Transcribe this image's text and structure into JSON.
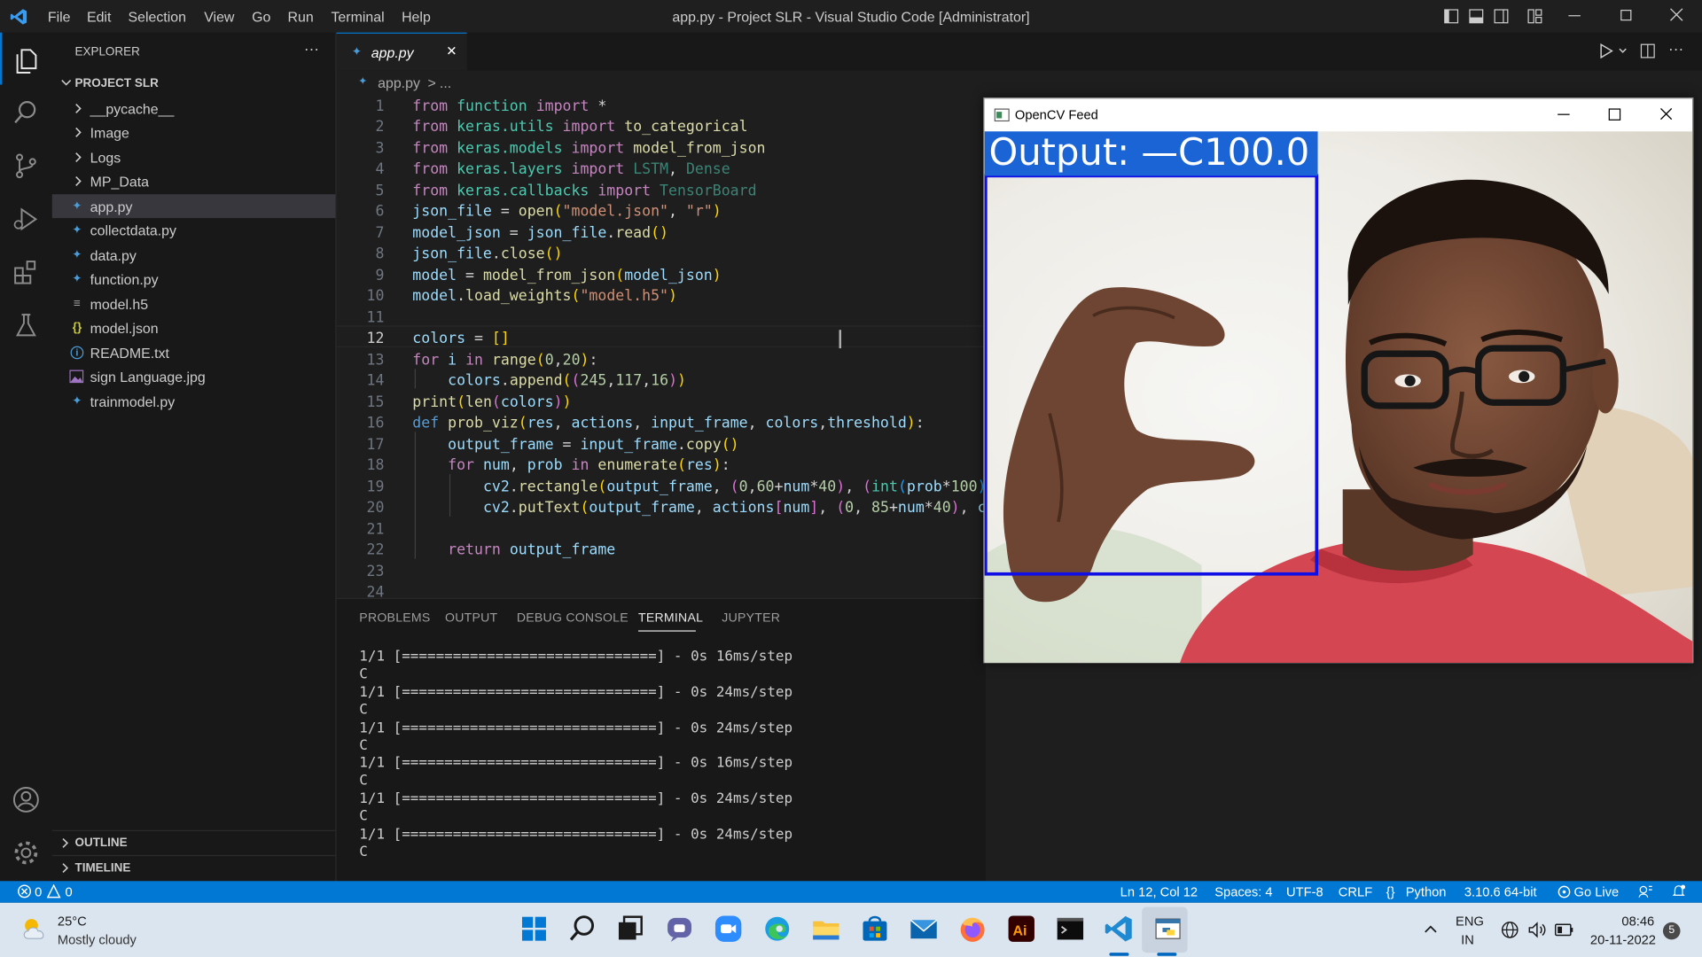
{
  "window": {
    "title": "app.py - Project SLR - Visual Studio Code [Administrator]"
  },
  "menu": [
    "File",
    "Edit",
    "Selection",
    "View",
    "Go",
    "Run",
    "Terminal",
    "Help"
  ],
  "sidebar": {
    "header": "EXPLORER",
    "more": "···",
    "project": "PROJECT SLR",
    "folders": [
      "__pycache__",
      "Image",
      "Logs",
      "MP_Data"
    ],
    "files": [
      "app.py",
      "collectdata.py",
      "data.py",
      "function.py",
      "model.h5",
      "model.json",
      "README.txt",
      "sign Language.jpg",
      "trainmodel.py"
    ],
    "outline": "OUTLINE",
    "timeline": "TIMELINE"
  },
  "tab": {
    "label": "app.py",
    "close": "✕"
  },
  "breadcrumb": {
    "file": "app.py",
    "sep": ">",
    "rest": "..."
  },
  "panel": {
    "tabs": [
      "PROBLEMS",
      "OUTPUT",
      "DEBUG CONSOLE",
      "TERMINAL",
      "JUPYTER"
    ],
    "active": "TERMINAL",
    "lines": [
      "1/1 [==============================] - 0s 16ms/step",
      "C",
      "1/1 [==============================] - 0s 24ms/step",
      "C",
      "1/1 [==============================] - 0s 24ms/step",
      "C",
      "1/1 [==============================] - 0s 16ms/step",
      "C",
      "1/1 [==============================] - 0s 24ms/step",
      "C",
      "1/1 [==============================] - 0s 24ms/step",
      "C"
    ]
  },
  "status": {
    "errors": "0",
    "warnings": "0",
    "position": "Ln 12, Col 12",
    "spaces": "Spaces: 4",
    "encoding": "UTF-8",
    "eol": "CRLF",
    "language": "Python",
    "interpreter": "3.10.6 64-bit",
    "golive": "Go Live"
  },
  "opencv": {
    "title": "OpenCV Feed",
    "output": "Output: —C100.0"
  },
  "taskbar": {
    "temp": "25°C",
    "weather": "Mostly cloudy",
    "lang1": "ENG",
    "lang2": "IN",
    "time": "08:46",
    "date": "20-11-2022",
    "notif": "5"
  },
  "colors": {
    "accent": "#0078d4",
    "statusbar": "#0078d4",
    "cv_box": "#1010e6"
  }
}
